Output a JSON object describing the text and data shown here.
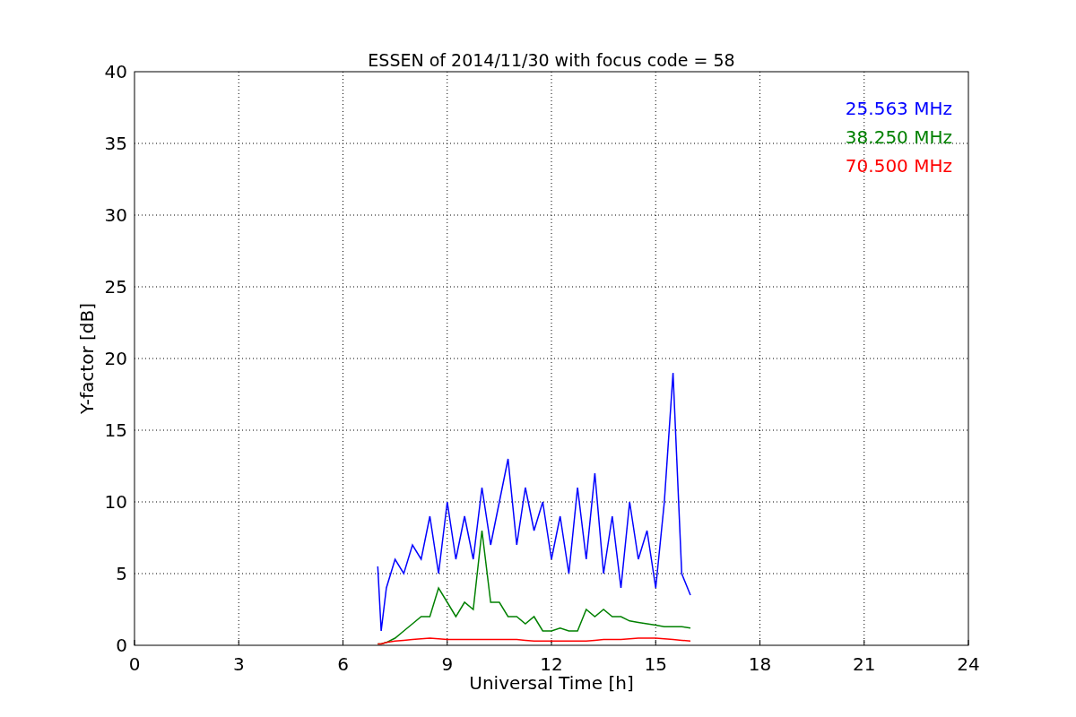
{
  "chart_data": {
    "type": "line",
    "title": "ESSEN of 2014/11/30 with focus code = 58",
    "xlabel": "Universal Time [h]",
    "ylabel": "Y-factor [dB]",
    "x": [
      7,
      7.1,
      7.25,
      7.5,
      7.75,
      8,
      8.25,
      8.5,
      8.75,
      9,
      9.25,
      9.5,
      9.75,
      10,
      10.25,
      10.5,
      10.75,
      11,
      11.25,
      11.5,
      11.75,
      12,
      12.25,
      12.5,
      12.75,
      13,
      13.25,
      13.5,
      13.75,
      14,
      14.25,
      14.5,
      14.75,
      15,
      15.25,
      15.5,
      15.75,
      16
    ],
    "series": [
      {
        "name": "25.563 MHz",
        "color": "#0000ff",
        "values": [
          5.5,
          1,
          4,
          6,
          5,
          7,
          6,
          9,
          5,
          10,
          6,
          9,
          6,
          11,
          7,
          10,
          13,
          7,
          11,
          8,
          10,
          6,
          9,
          5,
          11,
          6,
          12,
          5,
          9,
          4,
          10,
          6,
          8,
          4,
          10,
          19,
          5,
          3.5
        ]
      },
      {
        "name": "38.250 MHz",
        "color": "#008000",
        "values": [
          0.1,
          0.1,
          0.2,
          0.5,
          1,
          1.5,
          2,
          2,
          4,
          3,
          2,
          3,
          2.5,
          8,
          3,
          3,
          2,
          2,
          1.5,
          2,
          1,
          1,
          1.2,
          1,
          1,
          2.5,
          2,
          2.5,
          2,
          2,
          1.7,
          1.6,
          1.5,
          1.4,
          1.3,
          1.3,
          1.3,
          1.2
        ]
      },
      {
        "name": "70.500 MHz",
        "color": "#ff0000",
        "values": [
          0.1,
          0.1,
          0.2,
          0.3,
          0.35,
          0.4,
          0.45,
          0.5,
          0.45,
          0.4,
          0.4,
          0.4,
          0.4,
          0.4,
          0.4,
          0.4,
          0.4,
          0.4,
          0.35,
          0.3,
          0.3,
          0.3,
          0.3,
          0.3,
          0.3,
          0.3,
          0.35,
          0.4,
          0.4,
          0.4,
          0.45,
          0.5,
          0.5,
          0.5,
          0.45,
          0.4,
          0.35,
          0.3
        ]
      }
    ],
    "xlim": [
      0,
      24
    ],
    "ylim": [
      0,
      40
    ],
    "xticks": [
      0,
      3,
      6,
      9,
      12,
      15,
      18,
      21,
      24
    ],
    "yticks": [
      0,
      5,
      10,
      15,
      20,
      25,
      30,
      35,
      40
    ],
    "grid": true
  }
}
